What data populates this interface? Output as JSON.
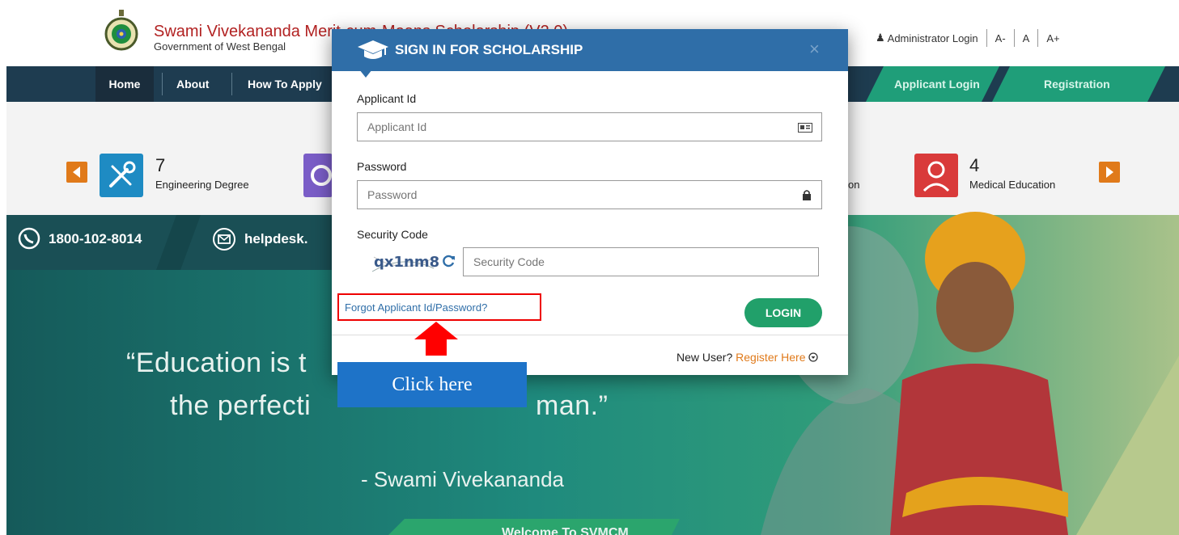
{
  "header": {
    "title": "Swami Vivekananda Merit-cum-Means Scholarship (V2.0)",
    "subtitle": "Government of West Bengal",
    "admin_login": "Administrator Login",
    "font_decrease": "A-",
    "font_normal": "A",
    "font_increase": "A+"
  },
  "nav": {
    "items": [
      {
        "label": "Home"
      },
      {
        "label": "About"
      },
      {
        "label": "How To Apply"
      }
    ],
    "applicant_login": "Applicant Login",
    "registration": "Registration"
  },
  "categories": [
    {
      "count": "7",
      "label": "Engineering Degree",
      "color": "#1e8bc3"
    },
    {
      "count": "",
      "label": "",
      "color": "#7a5dc7"
    },
    {
      "count": "",
      "label": "on",
      "color": ""
    },
    {
      "count": "4",
      "label": "Medical Education",
      "color": "#d93a3a"
    }
  ],
  "contact": {
    "phone": "1800-102-8014",
    "email": "helpdesk."
  },
  "hero": {
    "quote_line1": "“Education is t",
    "quote_line2_left": "the perfecti",
    "quote_line2_right": "man.”",
    "author": "- Swami Vivekananda",
    "welcome": "Welcome To SVMCM"
  },
  "modal": {
    "title": "SIGN IN FOR SCHOLARSHIP",
    "close": "×",
    "applicant_id_label": "Applicant Id",
    "applicant_id_placeholder": "Applicant Id",
    "password_label": "Password",
    "password_placeholder": "Password",
    "security_code_label": "Security Code",
    "captcha_text": "qx1nm8",
    "security_code_placeholder": "Security Code",
    "forgot_link": "Forgot Applicant Id/Password?",
    "login_button": "LOGIN",
    "new_user_text": "New User?",
    "register_link": "Register Here"
  },
  "annotation": {
    "callout_text": "Click here",
    "highlight_color": "#e00000",
    "callout_color": "#1e73c8"
  },
  "colors": {
    "modal_header": "#2f6ea8",
    "login_button": "#21a06a",
    "nav_background": "#1e3c50",
    "nav_green": "#1f9e79",
    "accent_orange": "#e07a1a"
  }
}
